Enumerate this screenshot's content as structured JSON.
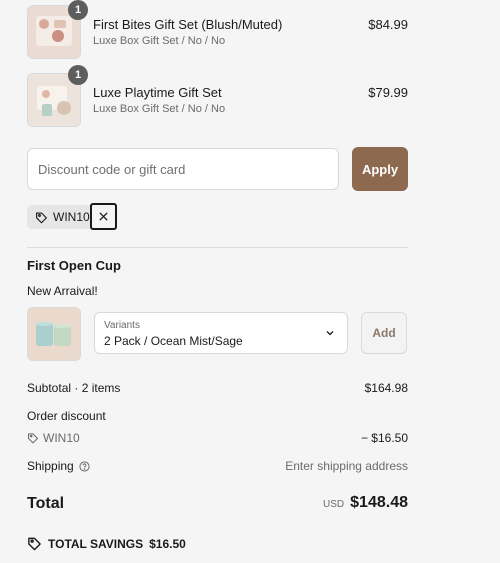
{
  "items": [
    {
      "qty": "1",
      "title": "First Bites Gift Set (Blush/Muted)",
      "variant": "Luxe Box Gift Set / No / No",
      "price": "$84.99"
    },
    {
      "qty": "1",
      "title": "Luxe Playtime Gift Set",
      "variant": "Luxe Box Gift Set / No / No",
      "price": "$79.99"
    }
  ],
  "discount": {
    "placeholder": "Discount code or gift card",
    "apply_label": "Apply",
    "applied_code": "WIN10"
  },
  "upsell": {
    "title": "First Open Cup",
    "subtitle": "New Arraival!",
    "variants_label": "Variants",
    "variants_value": "2 Pack / Ocean Mist/Sage",
    "add_label": "Add"
  },
  "summary": {
    "subtotal_label": "Subtotal · 2 items",
    "subtotal_value": "$164.98",
    "order_discount_label": "Order discount",
    "discount_code": "WIN10",
    "discount_value": "− $16.50",
    "shipping_label": "Shipping",
    "shipping_value": "Enter shipping address",
    "total_label": "Total",
    "currency": "USD",
    "total_value": "$148.48",
    "savings_label": "TOTAL SAVINGS",
    "savings_value": "$16.50"
  },
  "colors": {
    "accent": "#8d6a4f",
    "background": "#f5f5f5"
  }
}
